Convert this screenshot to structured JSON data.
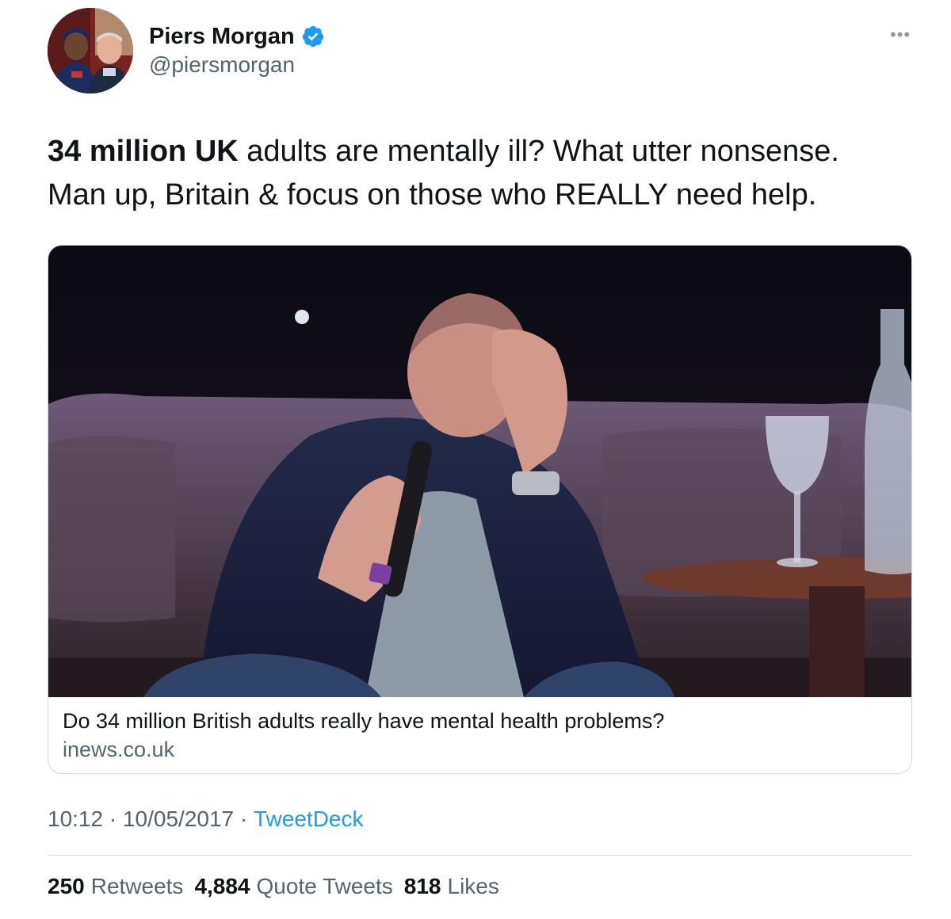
{
  "author": {
    "display_name": "Piers Morgan",
    "handle": "@piersmorgan",
    "verified": true,
    "avatar_icon": "profile-photo"
  },
  "more_icon": "ellipsis-icon",
  "tweet": {
    "bold_text": "34 million UK",
    "text_line1_rest": " adults are mentally ill? What utter nonsense.",
    "text_line2": "Man up, Britain & focus on those who REALLY need help."
  },
  "card": {
    "image": "photo of a man on a stage sofa holding a microphone, hand on forehead",
    "title": "Do 34 million British adults really have mental health problems?",
    "domain": "inews.co.uk"
  },
  "meta": {
    "time": "10:12",
    "separator": " · ",
    "date": "10/05/2017",
    "source": "TweetDeck"
  },
  "stats": {
    "retweets_count": "250",
    "retweets_label": "Retweets",
    "quotes_count": "4,884",
    "quotes_label": "Quote Tweets",
    "likes_count": "818",
    "likes_label": "Likes"
  },
  "colors": {
    "text": "#0f1419",
    "secondary": "#536471",
    "link": "#1d9bf0",
    "verified": "#1d9bf0",
    "border": "#cfd9de"
  }
}
